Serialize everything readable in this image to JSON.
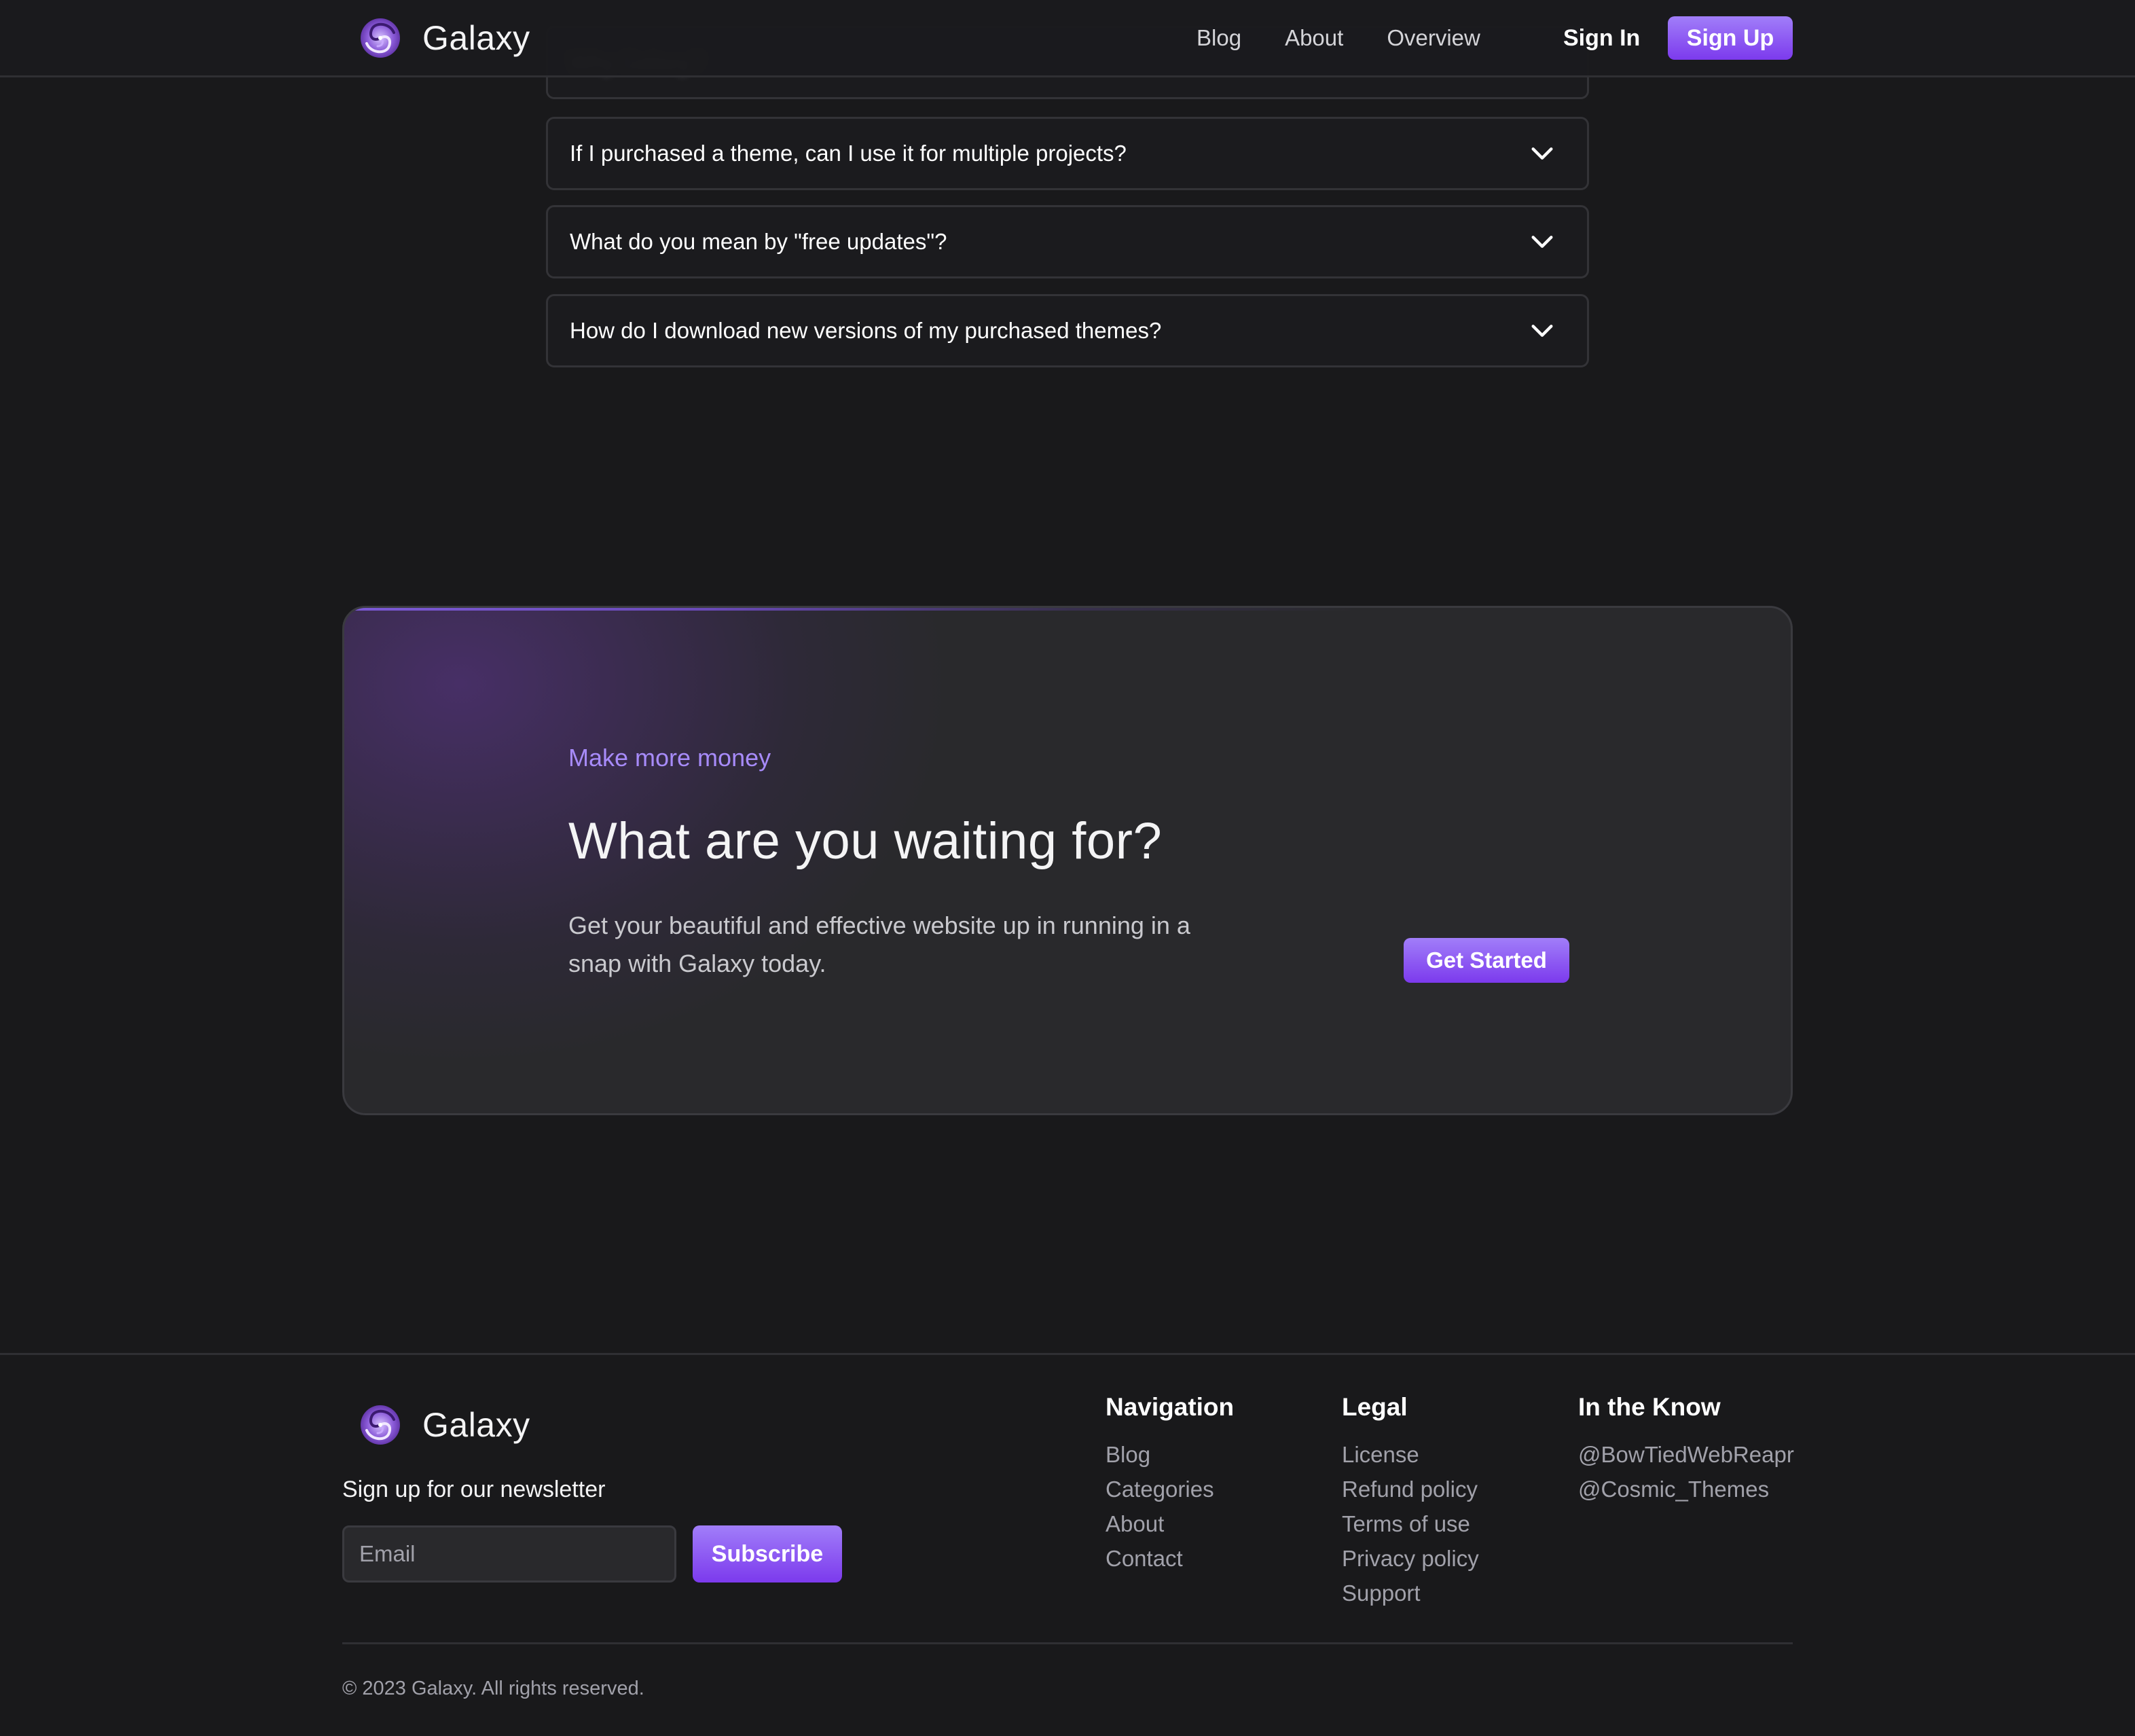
{
  "header": {
    "brand": "Galaxy",
    "logo_icon": "galaxy-spiral-icon",
    "nav": [
      {
        "label": "Blog"
      },
      {
        "label": "About"
      },
      {
        "label": "Overview"
      }
    ],
    "sign_in": "Sign In",
    "sign_up": "Sign Up"
  },
  "faq": {
    "partial_item": "Why Galaxy?",
    "items": [
      {
        "question": "If I purchased a theme, can I use it for multiple projects?",
        "icon": "chevron-down-icon"
      },
      {
        "question": "What do you mean by \"free updates\"?",
        "icon": "chevron-down-icon"
      },
      {
        "question": "How do I download new versions of my purchased themes?",
        "icon": "chevron-down-icon"
      }
    ]
  },
  "cta": {
    "eyebrow": "Make more money",
    "title": "What are you waiting for?",
    "body": "Get your beautiful and effective website up in running in a snap with Galaxy today.",
    "button": "Get Started"
  },
  "footer": {
    "brand": "Galaxy",
    "newsletter_label": "Sign up for our newsletter",
    "email_placeholder": "Email",
    "email_value": "",
    "subscribe": "Subscribe",
    "columns": [
      {
        "title": "Navigation",
        "links": [
          "Blog",
          "Categories",
          "About",
          "Contact"
        ]
      },
      {
        "title": "Legal",
        "links": [
          "License",
          "Refund policy",
          "Terms of use",
          "Privacy policy",
          "Support"
        ]
      },
      {
        "title": "In the Know",
        "links": [
          "@BowTiedWebReapr",
          "@Cosmic_Themes"
        ]
      }
    ],
    "copyright": "© 2023 Galaxy. All rights reserved."
  },
  "colors": {
    "background": "#19191b",
    "accent": "#8b5cf6",
    "accent_light": "#a78bfa",
    "card": "#29292c",
    "muted_text": "#a1a1aa"
  }
}
